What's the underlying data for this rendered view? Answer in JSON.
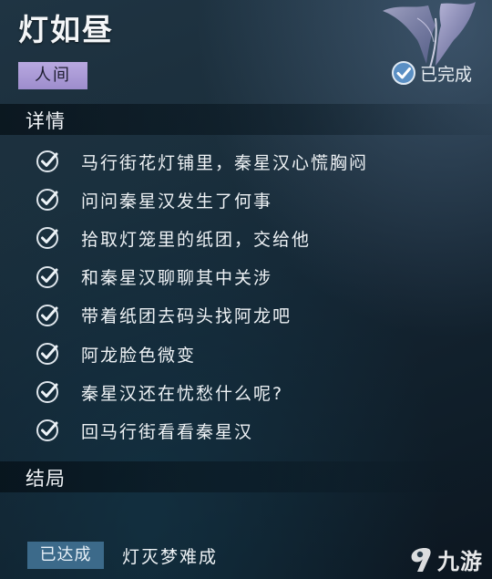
{
  "quest": {
    "title": "灯如昼",
    "category": "人间",
    "status": "已完成"
  },
  "details": {
    "header": "详情",
    "objectives": [
      "马行街花灯铺里，秦星汉心慌胸闷",
      "问问秦星汉发生了何事",
      "拾取灯笼里的纸团，交给他",
      "和秦星汉聊聊其中关涉",
      "带着纸团去码头找阿龙吧",
      "阿龙脸色微变",
      "秦星汉还在忧愁什么呢?",
      "回马行街看看秦星汉"
    ]
  },
  "ending": {
    "header": "结局",
    "badge": "已达成",
    "name": "灯灭梦难成"
  },
  "watermark": {
    "text": "九游",
    "logo_text": "九游"
  },
  "icons": {
    "objective_check": "check-circle-icon",
    "status_badge": "check-badge-icon",
    "ornament": "butterfly-emblem-icon",
    "watermark_logo": "nine-game-logo-icon"
  },
  "colors": {
    "category_tag": "#b8a8e0",
    "ending_badge": "#3c6a8a",
    "check_ring": "#dfe6ec",
    "status_badge": "#5a8fc4"
  }
}
